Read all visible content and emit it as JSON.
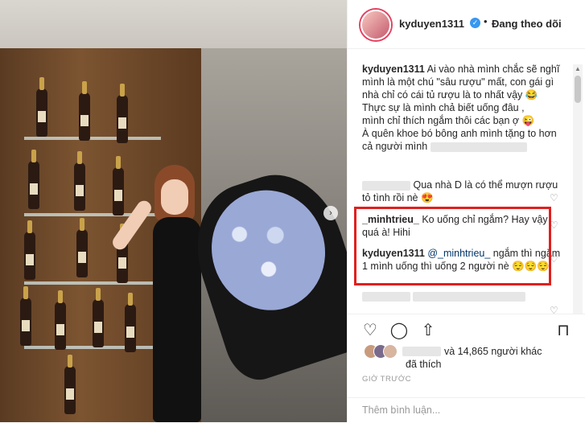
{
  "post_header": {
    "username": "kyduyen1311",
    "dot": "•",
    "follow_label": "Đang theo dõi"
  },
  "comments": [
    {
      "username": "kyduyen1311",
      "text": " Ai vào nhà mình chắc sẽ nghĩ mình là một chú \"sâu rượu\" mất, con gái gì nhà chỉ có cái tủ rượu là to nhất vậy 😂",
      "text2": "Thực sự là mình chả biết uống đâu ,",
      "text3": "mình chỉ thích ngắm thôi các bạn ợ 😜",
      "text4": "À quên khoe bó bông anh mình tặng to hơn cả người mình"
    },
    {
      "text": "Qua nhà D là có thể mượn rượu tỏ tình rồi nè 😍"
    },
    {
      "username": "_minhtrieu_",
      "text": " Ko uống chỉ ngắm? Hay vậy quá à! Hihi"
    },
    {
      "username": "kyduyen1311",
      "mention": " @_minhtrieu_",
      "text": " ngắm thì ngắm 1 mình uống thì uống 2 người nè 😌😌😌"
    }
  ],
  "likes": {
    "text": "và 14,865 người khác",
    "text2": "đã thích"
  },
  "timestamp": "GIỜ TRƯỚC",
  "comment_input": {
    "placeholder": "Thêm bình luận..."
  }
}
